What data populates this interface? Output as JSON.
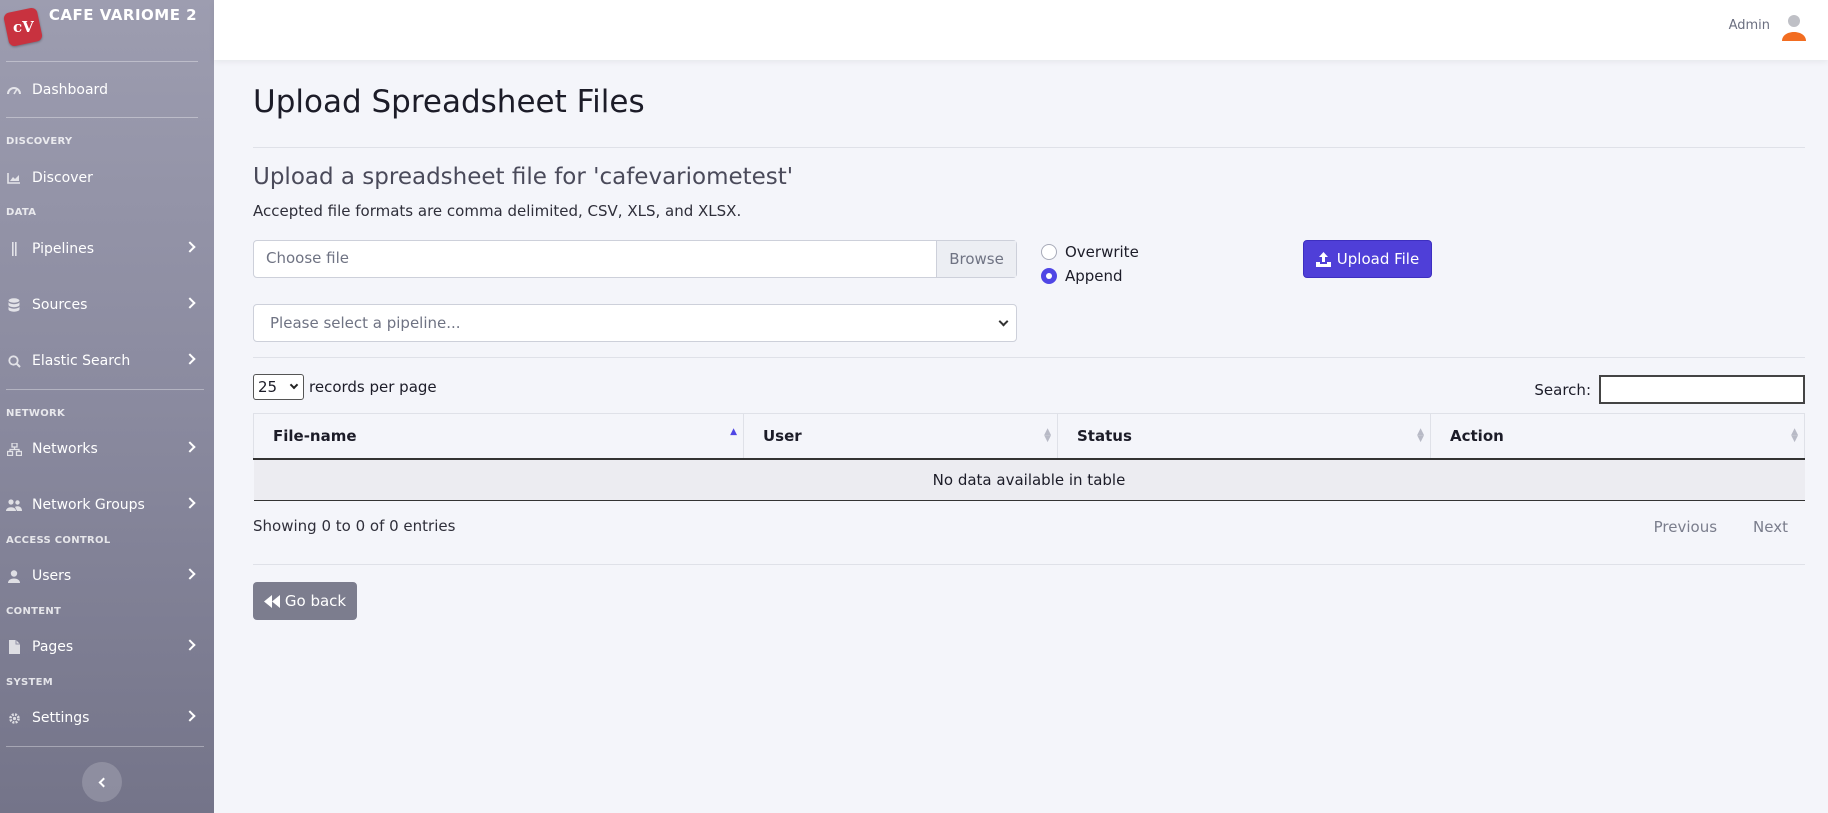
{
  "brand": {
    "name": "CAFE VARIOME 2",
    "logo_text": "cV",
    "logo_color": "#c8323f"
  },
  "sidebar": {
    "items": [
      {
        "label": "Dashboard",
        "icon": "gauge-icon"
      },
      {
        "section": "DISCOVERY"
      },
      {
        "label": "Discover",
        "icon": "chart-area-icon"
      },
      {
        "section": "DATA"
      },
      {
        "label": "Pipelines",
        "icon": "pipeline-icon"
      },
      {
        "label": "Sources",
        "icon": "database-icon"
      },
      {
        "label": "Elastic Search",
        "icon": "search-icon"
      },
      {
        "section": "NETWORK"
      },
      {
        "label": "Networks",
        "icon": "network-icon"
      },
      {
        "label": "Network Groups",
        "icon": "users-icon"
      },
      {
        "section": "ACCESS CONTROL"
      },
      {
        "label": "Users",
        "icon": "user-icon"
      },
      {
        "section": "CONTENT"
      },
      {
        "label": "Pages",
        "icon": "file-icon"
      },
      {
        "section": "SYSTEM"
      },
      {
        "label": "Settings",
        "icon": "gear-icon"
      }
    ],
    "collapse_icon": "chevron-left-icon"
  },
  "topbar": {
    "user_label": "Admin",
    "avatar_icon": "user-avatar-icon"
  },
  "page": {
    "title": "Upload Spreadsheet Files",
    "subtitle": "Upload a spreadsheet file for 'cafevariometest'",
    "formats_note": "Accepted file formats are comma delimited, CSV, XLS, and XLSX."
  },
  "upload_form": {
    "file_placeholder": "Choose file",
    "browse_label": "Browse",
    "radio_overwrite": "Overwrite",
    "radio_append": "Append",
    "selected_mode": "Append",
    "upload_button": "Upload File",
    "pipeline_placeholder": "Please select a pipeline..."
  },
  "table": {
    "page_size": "25",
    "page_size_label": "records per page",
    "search_label": "Search:",
    "columns": [
      "File-name",
      "User",
      "Status",
      "Action"
    ],
    "sorted_column": "File-name",
    "empty_message": "No data available in table",
    "info": "Showing 0 to 0 of 0 entries",
    "prev_label": "Previous",
    "next_label": "Next"
  },
  "back_button": "Go back",
  "colors": {
    "accent": "#4f3fd8",
    "sidebar_top": "#9d9db0",
    "sidebar_bottom": "#747489",
    "back_button": "#7c7d8e"
  }
}
